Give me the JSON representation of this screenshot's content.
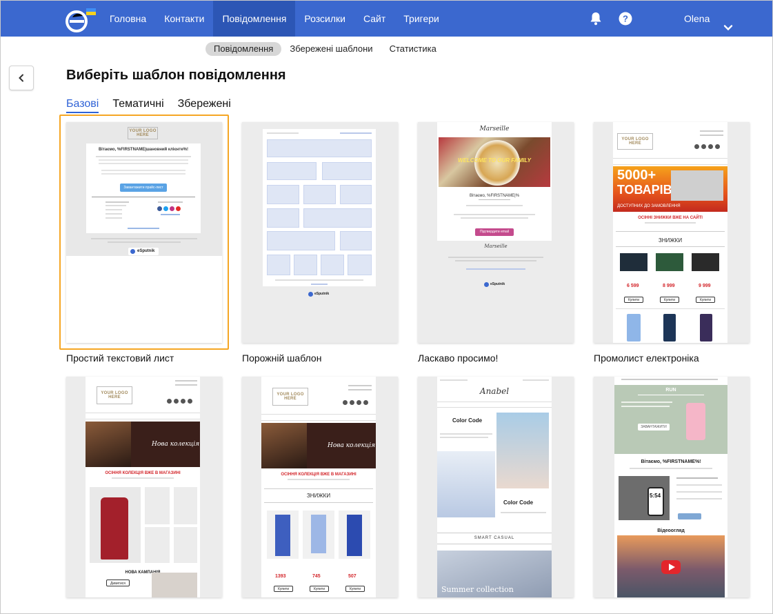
{
  "colors": {
    "topbar": "#3b68cf",
    "nav_active": "#2c56b5",
    "accent": "#2f62d6",
    "selected_outline": "#f5a623"
  },
  "nav": {
    "items": [
      {
        "label": "Головна",
        "active": false
      },
      {
        "label": "Контакти",
        "active": false
      },
      {
        "label": "Повідомлення",
        "active": true
      },
      {
        "label": "Розсилки",
        "active": false
      },
      {
        "label": "Сайт",
        "active": false
      },
      {
        "label": "Тригери",
        "active": false
      }
    ],
    "icons": [
      "bell-icon",
      "help-icon"
    ],
    "user_name": "Olena"
  },
  "subtabs": [
    {
      "label": "Повідомлення",
      "active": true
    },
    {
      "label": "Збережені шаблони",
      "active": false
    },
    {
      "label": "Статистика",
      "active": false
    }
  ],
  "page_title": "Виберіть шаблон повідомлення",
  "category_tabs": [
    {
      "label": "Базові",
      "active": true
    },
    {
      "label": "Тематичні",
      "active": false
    },
    {
      "label": "Збережені",
      "active": false
    }
  ],
  "templates": [
    {
      "label": "Простий текстовий лист",
      "selected": true
    },
    {
      "label": "Порожній шаблон",
      "selected": false
    },
    {
      "label": "Ласкаво просимо!",
      "selected": false
    },
    {
      "label": "Промолист електроніка",
      "selected": false
    },
    {
      "label": "",
      "selected": false
    },
    {
      "label": "",
      "selected": false
    },
    {
      "label": "",
      "selected": false
    },
    {
      "label": "",
      "selected": false
    }
  ],
  "thumbs": {
    "simple": {
      "logo": "YOUR LOGO HERE",
      "greeting": "Вітаємо, %FIRSTNAME|шановний клієнте%!",
      "button": "Завантажити прайс-лист",
      "footer_brand": "eSputnik"
    },
    "blank": {
      "footer_brand": "eSputnik"
    },
    "welcome": {
      "brand": "Marseille",
      "banner": "WELCOME TO OUR FAMILY",
      "greeting": "Вітаємо, %FIRSTNAME|%",
      "button": "Підтвердити email",
      "footer_brand": "eSputnik"
    },
    "electronics": {
      "logo": "YOUR LOGO HERE",
      "banner_line1": "5000+",
      "banner_line2": "ТОВАРІВ",
      "banner_line3": "ДОСТУПНИХ ДО ЗАМОВЛЕННЯ",
      "sale": "ОСІННІ ЗНИЖКИ ВЖЕ НА САЙТІ",
      "discounts": "ЗНИЖКИ",
      "buy": "Купити"
    },
    "fashion1": {
      "logo": "YOUR LOGO HERE",
      "banner": "Нова колекція",
      "sale": "ОСІННЯ КОЛЕКЦІЯ ВЖЕ В МАГАЗИНІ",
      "campaign": "НОВА КАМПАНІЯ",
      "view": "Дивитися"
    },
    "fashion2": {
      "logo": "YOUR LOGO HERE",
      "banner": "Нова колекція",
      "sale": "ОСІННЯ КОЛЕКЦІЯ ВЖЕ В МАГАЗИНІ",
      "discounts": "ЗНИЖКИ",
      "prices": [
        "1393",
        "745",
        "507"
      ],
      "buy": "Купити"
    },
    "anabel": {
      "brand": "Anabel",
      "heading1": "Color Code",
      "heading2": "Color Code",
      "smart": "SMART CASUAL",
      "summer": "Summer collection"
    },
    "run": {
      "header": "RUN",
      "greeting": "Вітаємо, %FIRSTNAME%!",
      "time": "5:54",
      "video_title": "Відеоогляд",
      "download": "ЗАВАНТАЖИТИ"
    }
  }
}
